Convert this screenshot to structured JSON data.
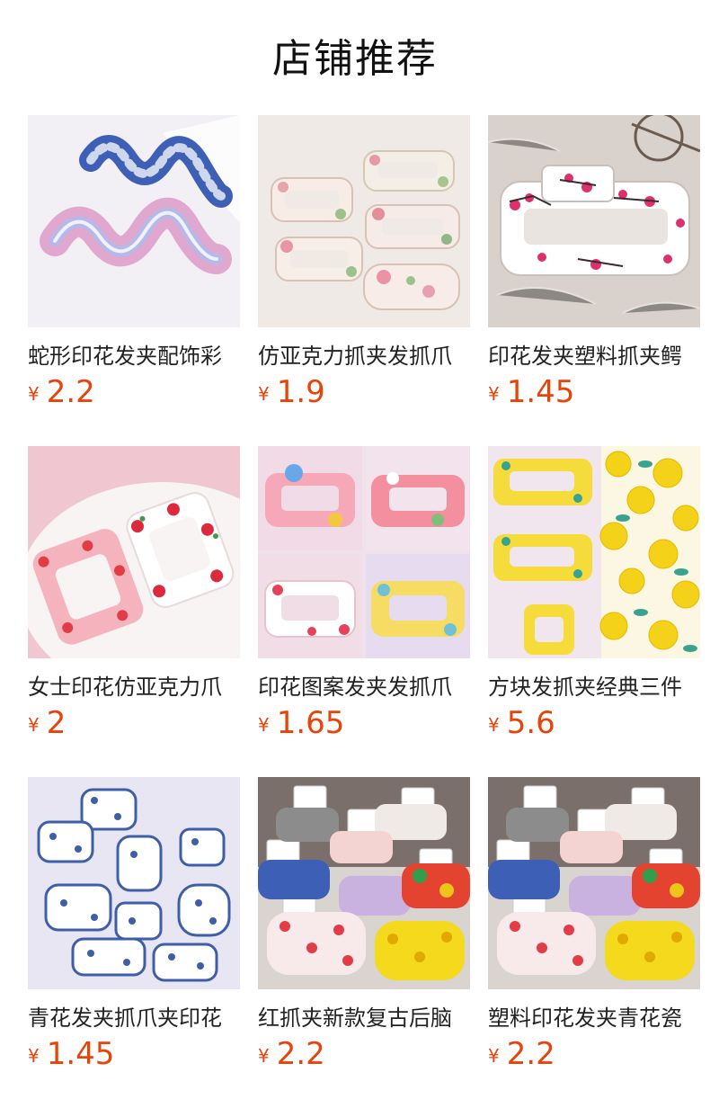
{
  "header": {
    "title": "店铺推荐"
  },
  "currency_symbol": "¥",
  "accent_color": "#e8430a",
  "products": [
    {
      "name": "蛇形印花发夹配饰彩",
      "price": "2.2",
      "image": "wavy-claw-clip-photo"
    },
    {
      "name": "仿亚克力抓夹发抓爪",
      "price": "1.9",
      "image": "floral-claw-clips-photo"
    },
    {
      "name": "印花发夹塑料抓夹鳄",
      "price": "1.45",
      "image": "plum-blossom-claw-clip-photo"
    },
    {
      "name": "女士印花仿亚克力爪",
      "price": "2",
      "image": "cherry-claw-clips-photo"
    },
    {
      "name": "印花图案发夹发抓爪",
      "price": "1.65",
      "image": "pattern-claw-clips-photo"
    },
    {
      "name": "方块发抓夹经典三件",
      "price": "5.6",
      "image": "lemon-claw-clips-photo"
    },
    {
      "name": "青花发夹抓爪夹印花",
      "price": "1.45",
      "image": "blue-white-claw-clips-photo"
    },
    {
      "name": "红抓夹新款复古后脑",
      "price": "2.2",
      "image": "carded-claw-clips-photo"
    },
    {
      "name": "塑料印花发夹青花瓷",
      "price": "2.2",
      "image": "carded-claw-clips-photo"
    }
  ]
}
